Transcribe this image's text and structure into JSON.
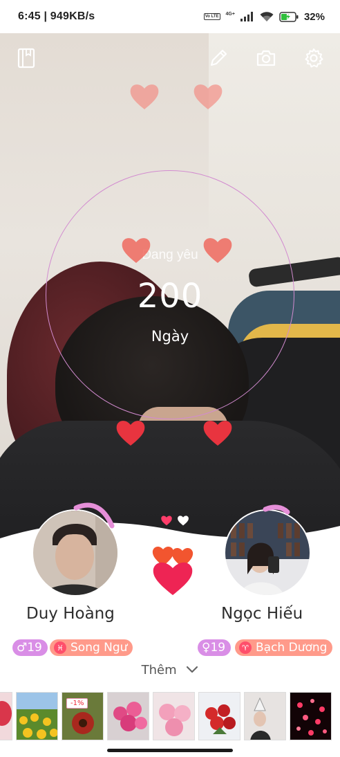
{
  "status_bar": {
    "time_speed": "6:45 | 949KB/s",
    "volte": "Vo LTE",
    "network": "4G+",
    "battery": "32%"
  },
  "toolbar": {
    "notebook_icon": "notebook-icon",
    "edit_icon": "pencil-icon",
    "camera_icon": "camera-icon",
    "settings_icon": "gear-icon"
  },
  "counter": {
    "label": "Đang yêu",
    "value": "200",
    "unit": "Ngày"
  },
  "people": [
    {
      "name": "Duy Hoàng",
      "gender_tag": "♂19",
      "zodiac_symbol": "♓",
      "zodiac": "Song Ngư"
    },
    {
      "name": "Ngọc Hiếu",
      "gender_tag": "♀19",
      "zodiac_symbol": "♈",
      "zodiac": "Bạch Dương"
    }
  ],
  "more_label": "Thêm",
  "thumbnails": [
    {
      "badge": ""
    },
    {
      "badge": ""
    },
    {
      "badge": "-1%"
    },
    {
      "badge": ""
    },
    {
      "badge": ""
    },
    {
      "badge": ""
    },
    {
      "badge": ""
    },
    {
      "badge": ""
    }
  ],
  "colors": {
    "ring": "#d28bd0",
    "gender_tag": "#d98ee6",
    "zodiac_tag": "#ff9a8a",
    "heart": "#e8343f"
  }
}
